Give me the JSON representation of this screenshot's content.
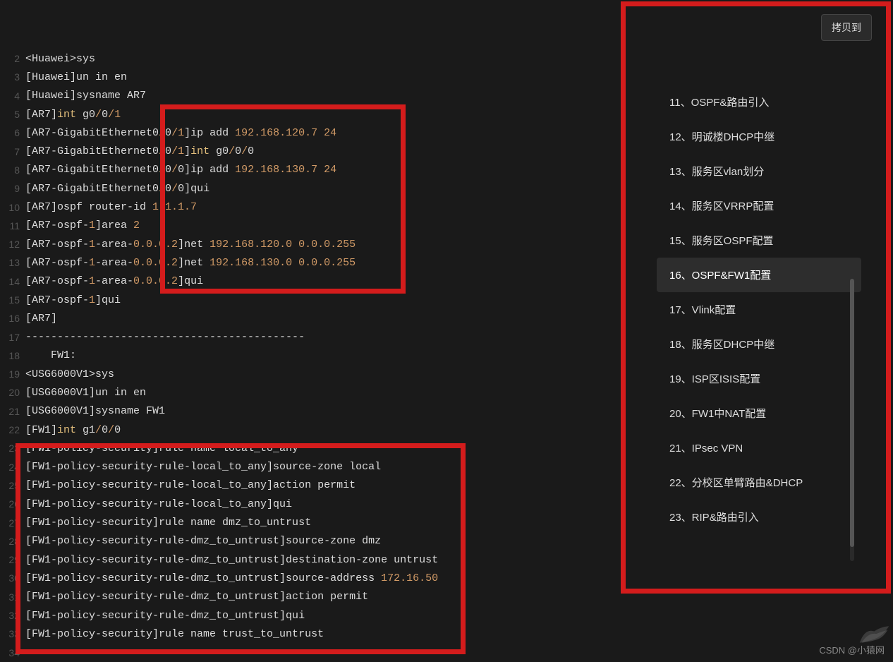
{
  "lines": [
    {
      "no": 2,
      "tokens": [
        [
          "w",
          "<Huawei>sys"
        ]
      ]
    },
    {
      "no": 3,
      "tokens": [
        [
          "w",
          "[Huawei]un in en"
        ]
      ]
    },
    {
      "no": 4,
      "tokens": [
        [
          "w",
          "[Huawei]sysname AR7"
        ]
      ]
    },
    {
      "no": 5,
      "tokens": [
        [
          "w",
          "[AR7]"
        ],
        [
          "i",
          "int"
        ],
        [
          "w",
          " g0"
        ],
        [
          "n",
          "/"
        ],
        [
          "w",
          "0"
        ],
        [
          "n",
          "/1"
        ]
      ]
    },
    {
      "no": 6,
      "tokens": [
        [
          "w",
          "[AR7-GigabitEthernet0"
        ],
        [
          "n",
          "/"
        ],
        [
          "w",
          "0"
        ],
        [
          "n",
          "/1"
        ],
        [
          "w",
          "]ip add "
        ],
        [
          "n",
          "192.168.120.7 24"
        ]
      ]
    },
    {
      "no": 7,
      "tokens": [
        [
          "w",
          "[AR7-GigabitEthernet0"
        ],
        [
          "n",
          "/"
        ],
        [
          "w",
          "0"
        ],
        [
          "n",
          "/1"
        ],
        [
          "w",
          "]"
        ],
        [
          "i",
          "int"
        ],
        [
          "w",
          " g0"
        ],
        [
          "n",
          "/"
        ],
        [
          "w",
          "0"
        ],
        [
          "n",
          "/"
        ],
        [
          "w",
          "0"
        ]
      ]
    },
    {
      "no": 8,
      "tokens": [
        [
          "w",
          "[AR7-GigabitEthernet0"
        ],
        [
          "n",
          "/"
        ],
        [
          "w",
          "0"
        ],
        [
          "n",
          "/"
        ],
        [
          "w",
          "0]ip add "
        ],
        [
          "n",
          "192.168.130.7 24"
        ]
      ]
    },
    {
      "no": 9,
      "tokens": [
        [
          "w",
          "[AR7-GigabitEthernet0"
        ],
        [
          "n",
          "/"
        ],
        [
          "w",
          "0"
        ],
        [
          "n",
          "/"
        ],
        [
          "w",
          "0]qui"
        ]
      ]
    },
    {
      "no": 10,
      "tokens": [
        [
          "w",
          "[AR7]ospf router-id "
        ],
        [
          "n",
          "1.1.1.7"
        ]
      ]
    },
    {
      "no": 11,
      "tokens": [
        [
          "w",
          "[AR7-ospf-"
        ],
        [
          "n",
          "1"
        ],
        [
          "w",
          "]area "
        ],
        [
          "n",
          "2"
        ]
      ]
    },
    {
      "no": 12,
      "tokens": [
        [
          "w",
          "[AR7-ospf-"
        ],
        [
          "n",
          "1"
        ],
        [
          "w",
          "-area-"
        ],
        [
          "n",
          "0.0.0.2"
        ],
        [
          "w",
          "]net "
        ],
        [
          "n",
          "192.168.120.0 0.0.0.255"
        ]
      ]
    },
    {
      "no": 13,
      "tokens": [
        [
          "w",
          "[AR7-ospf-"
        ],
        [
          "n",
          "1"
        ],
        [
          "w",
          "-area-"
        ],
        [
          "n",
          "0.0.0.2"
        ],
        [
          "w",
          "]net "
        ],
        [
          "n",
          "192.168.130.0 0.0.0.255"
        ]
      ]
    },
    {
      "no": 14,
      "tokens": [
        [
          "w",
          "[AR7-ospf-"
        ],
        [
          "n",
          "1"
        ],
        [
          "w",
          "-area-"
        ],
        [
          "n",
          "0.0.0.2"
        ],
        [
          "w",
          "]qui"
        ]
      ]
    },
    {
      "no": 15,
      "tokens": [
        [
          "w",
          "[AR7-ospf-"
        ],
        [
          "n",
          "1"
        ],
        [
          "w",
          "]qui"
        ]
      ]
    },
    {
      "no": 16,
      "tokens": [
        [
          "w",
          "[AR7]"
        ]
      ]
    },
    {
      "no": 17,
      "tokens": [
        [
          "w",
          "--------------------------------------------"
        ]
      ]
    },
    {
      "no": 18,
      "tokens": [
        [
          "w",
          "    FW1:"
        ]
      ]
    },
    {
      "no": 19,
      "tokens": [
        [
          "w",
          "<USG6000V1>sys"
        ]
      ]
    },
    {
      "no": 20,
      "tokens": [
        [
          "w",
          "[USG6000V1]un in en"
        ]
      ]
    },
    {
      "no": 21,
      "tokens": [
        [
          "w",
          "[USG6000V1]sysname FW1"
        ]
      ]
    },
    {
      "no": 22,
      "tokens": [
        [
          "w",
          "[FW1]"
        ],
        [
          "i",
          "int"
        ],
        [
          "w",
          " g1"
        ],
        [
          "n",
          "/"
        ],
        [
          "w",
          "0"
        ],
        [
          "n",
          "/"
        ],
        [
          "w",
          "0"
        ]
      ]
    },
    {
      "no": 23,
      "tokens": [
        [
          "w",
          "[FW1-policy-security]rule name local_to_any"
        ]
      ]
    },
    {
      "no": 24,
      "tokens": [
        [
          "w",
          "[FW1-policy-security-rule-local_to_any]source-zone local"
        ]
      ]
    },
    {
      "no": 25,
      "tokens": [
        [
          "w",
          "[FW1-policy-security-rule-local_to_any]action permit"
        ]
      ]
    },
    {
      "no": 26,
      "tokens": [
        [
          "w",
          "[FW1-policy-security-rule-local_to_any]qui"
        ]
      ]
    },
    {
      "no": 27,
      "tokens": [
        [
          "w",
          "[FW1-policy-security]rule name dmz_to_untrust"
        ]
      ]
    },
    {
      "no": 28,
      "tokens": [
        [
          "w",
          "[FW1-policy-security-rule-dmz_to_untrust]source-zone dmz"
        ]
      ]
    },
    {
      "no": 29,
      "tokens": [
        [
          "w",
          "[FW1-policy-security-rule-dmz_to_untrust]destination-zone untrust"
        ]
      ]
    },
    {
      "no": 30,
      "tokens": [
        [
          "w",
          "[FW1-policy-security-rule-dmz_to_untrust]source-address "
        ],
        [
          "n",
          "172.16.50"
        ]
      ]
    },
    {
      "no": 31,
      "tokens": [
        [
          "w",
          "[FW1-policy-security-rule-dmz_to_untrust]action permit"
        ]
      ]
    },
    {
      "no": 32,
      "tokens": [
        [
          "w",
          "[FW1-policy-security-rule-dmz_to_untrust]qui"
        ]
      ]
    },
    {
      "no": 33,
      "tokens": [
        [
          "w",
          "[FW1-policy-security]rule name trust_to_untrust"
        ]
      ]
    },
    {
      "no": 34,
      "tokens": [
        [
          "w",
          " "
        ]
      ]
    }
  ],
  "copy_btn_label": "拷贝到",
  "toc": [
    {
      "label": "11、OSPF&路由引入",
      "active": false
    },
    {
      "label": "12、明诚楼DHCP中继",
      "active": false
    },
    {
      "label": "13、服务区vlan划分",
      "active": false
    },
    {
      "label": "14、服务区VRRP配置",
      "active": false
    },
    {
      "label": "15、服务区OSPF配置",
      "active": false
    },
    {
      "label": "16、OSPF&FW1配置",
      "active": true
    },
    {
      "label": "17、Vlink配置",
      "active": false
    },
    {
      "label": "18、服务区DHCP中继",
      "active": false
    },
    {
      "label": "19、ISP区ISIS配置",
      "active": false
    },
    {
      "label": "20、FW1中NAT配置",
      "active": false
    },
    {
      "label": "21、IPsec VPN",
      "active": false
    },
    {
      "label": "22、分校区单臂路由&DHCP",
      "active": false
    },
    {
      "label": "23、RIP&路由引入",
      "active": false
    }
  ],
  "watermark": "CSDN @小猿网"
}
